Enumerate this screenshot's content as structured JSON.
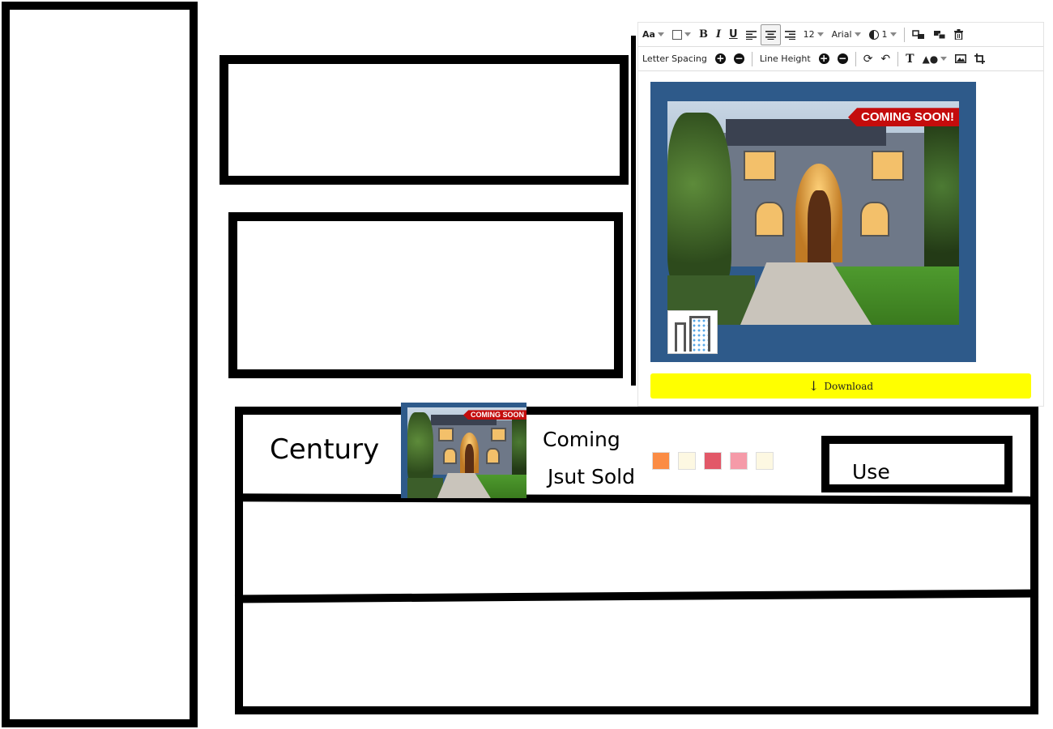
{
  "toolbar": {
    "font_style": "Aa",
    "font_size": "12",
    "font_family": "Arial",
    "opacity_value": "1",
    "letter_spacing_label": "Letter Spacing",
    "line_height_label": "Line Height"
  },
  "preview": {
    "banner_text": "COMING SOON!"
  },
  "download_button": {
    "label": "Download"
  },
  "template_row": {
    "name": "Century",
    "thumb_banner": "COMING SOON",
    "tags": [
      "Coming",
      "Jsut Sold"
    ],
    "swatches": [
      "#fb8c44",
      "#fdf8e2",
      "#e25868",
      "#f59aa8",
      "#fdf8e2"
    ],
    "use_label": "Use"
  },
  "colors": {
    "accent_yellow": "#ffff00",
    "banner_red": "#c40c0c",
    "frame_blue": "#2e5a8a"
  }
}
